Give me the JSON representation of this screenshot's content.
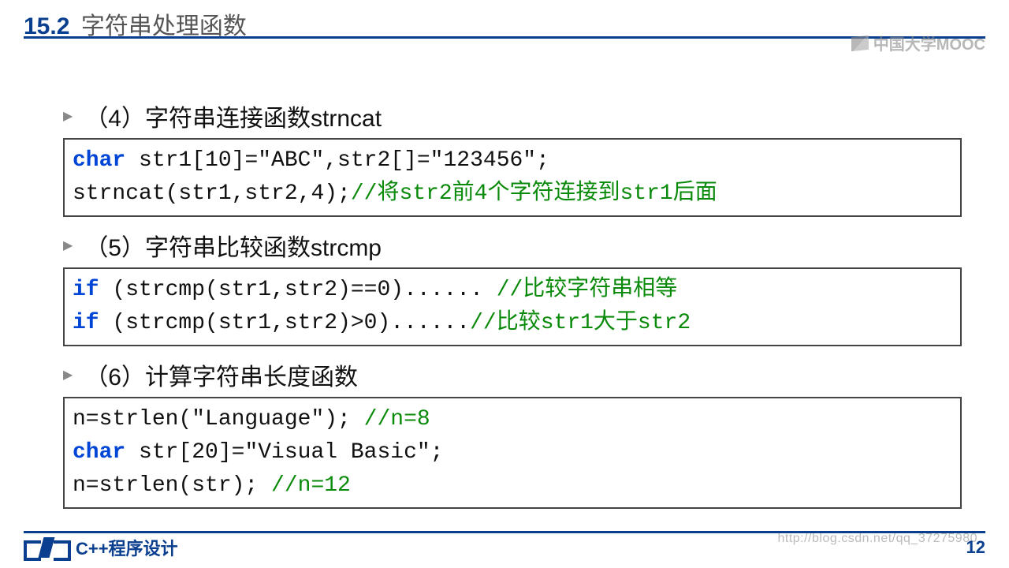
{
  "header": {
    "section_number": "15.2",
    "section_title": "字符串处理函数"
  },
  "watermark": "中国大学MOOC",
  "items": [
    {
      "bullet": "（4）字符串连接函数strncat",
      "code": [
        {
          "segments": [
            {
              "t": "char ",
              "c": "kw"
            },
            {
              "t": "str1[10]=\"ABC\",str2[]=\"123456\";",
              "c": "txt"
            }
          ]
        },
        {
          "segments": [
            {
              "t": "strncat(str1,str2,4);",
              "c": "txt"
            },
            {
              "t": "//将str2前4个字符连接到str1后面",
              "c": "cm"
            }
          ]
        }
      ]
    },
    {
      "bullet": "（5）字符串比较函数strcmp",
      "code": [
        {
          "segments": [
            {
              "t": "if ",
              "c": "kw"
            },
            {
              "t": "(strcmp(str1,str2)==0)...... ",
              "c": "txt"
            },
            {
              "t": "//比较字符串相等",
              "c": "cm"
            }
          ]
        },
        {
          "segments": [
            {
              "t": "if ",
              "c": "kw"
            },
            {
              "t": "(strcmp(str1,str2)>0)......",
              "c": "txt"
            },
            {
              "t": "//比较str1大于str2",
              "c": "cm"
            }
          ]
        }
      ]
    },
    {
      "bullet": "（6）计算字符串长度函数",
      "code": [
        {
          "segments": [
            {
              "t": "n=strlen(\"Language\"); ",
              "c": "txt"
            },
            {
              "t": "//n=8",
              "c": "cm"
            }
          ]
        },
        {
          "segments": [
            {
              "t": "char ",
              "c": "kw"
            },
            {
              "t": "str[20]=\"Visual Basic\";",
              "c": "txt"
            }
          ]
        },
        {
          "segments": [
            {
              "t": "n=strlen(str); ",
              "c": "txt"
            },
            {
              "t": "//n=12",
              "c": "cm"
            }
          ]
        }
      ]
    }
  ],
  "footer": {
    "logo_text": "C++程序设计",
    "page_number": "12"
  },
  "blog_watermark": "http://blog.csdn.net/qq_37275980"
}
